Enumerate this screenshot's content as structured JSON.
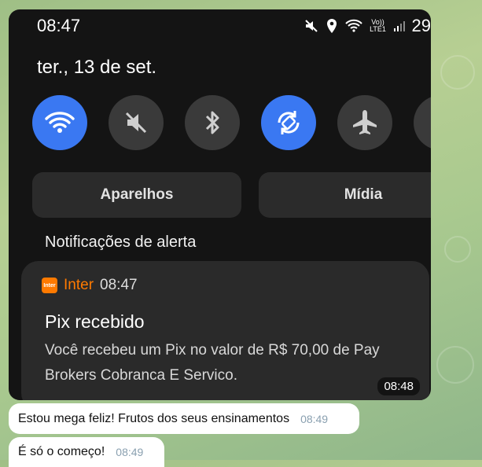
{
  "phone": {
    "status_time": "08:47",
    "network_label": "Vo)) LTE1",
    "battery": "29",
    "date": "ter., 13 de set.",
    "quick_settings": [
      {
        "name": "wifi",
        "on": true
      },
      {
        "name": "mute",
        "on": false
      },
      {
        "name": "bluetooth",
        "on": false
      },
      {
        "name": "auto-rotate",
        "on": true
      },
      {
        "name": "airplane",
        "on": false
      }
    ],
    "devices_label": "Aparelhos",
    "media_label": "Mídia",
    "section_title": "Notificações de alerta",
    "notification": {
      "app_logo_text": "Inter",
      "app_name": "Inter",
      "time": "08:47",
      "title": "Pix recebido",
      "body": "Você recebeu um Pix no valor de R$ 70,00 de Pay Brokers Cobranca E Servico."
    }
  },
  "image_timestamp": "08:48",
  "messages": [
    {
      "text": "Estou mega feliz! Frutos dos seus ensinamentos",
      "time": "08:49"
    },
    {
      "text": "É só o começo!",
      "time": "08:49"
    }
  ]
}
